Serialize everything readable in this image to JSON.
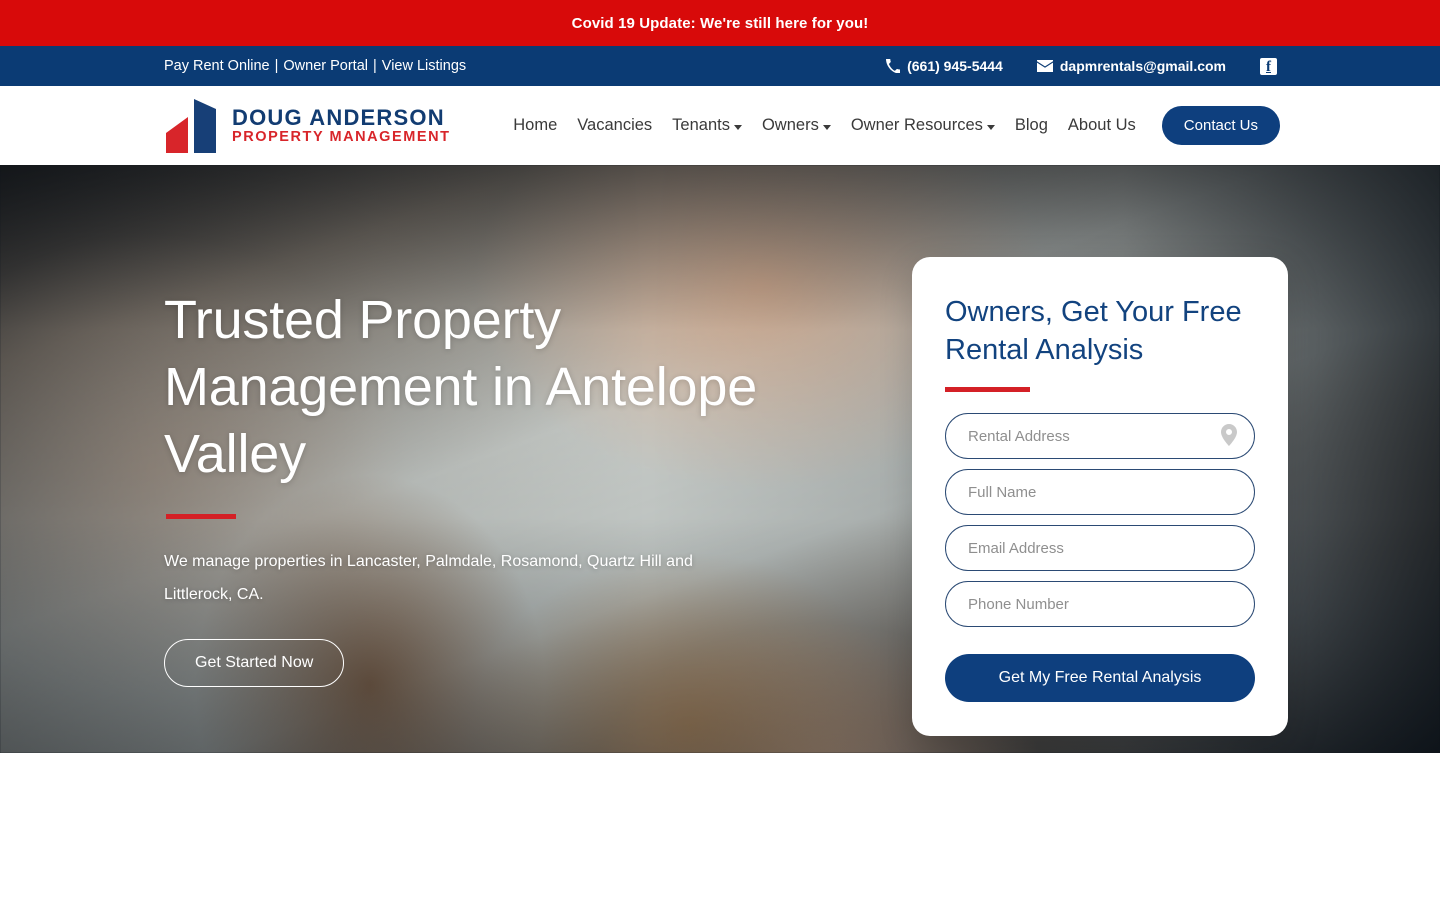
{
  "announcement": {
    "text": "Covid 19 Update: We're still here for you!",
    "bg_color": "#d80a0a",
    "text_color": "#ffffff"
  },
  "utility_bar": {
    "bg_color": "#0b3b74",
    "links": [
      {
        "label": "Pay Rent Online"
      },
      {
        "label": "Owner Portal"
      },
      {
        "label": "View Listings"
      }
    ],
    "separator": "|",
    "phone": {
      "icon": "phone-icon",
      "label": "(661) 945-5444"
    },
    "email": {
      "icon": "envelope-icon",
      "label": "dapmrentals@gmail.com"
    },
    "social": {
      "icon": "facebook-icon",
      "label": "f"
    }
  },
  "header": {
    "logo": {
      "icon": "building-logo-icon",
      "line1": "DOUG ANDERSON",
      "line2": "PROPERTY MANAGEMENT",
      "line1_color": "#123c72",
      "line2_color": "#d8252a"
    },
    "nav": [
      {
        "label": "Home",
        "has_dropdown": false
      },
      {
        "label": "Vacancies",
        "has_dropdown": false
      },
      {
        "label": "Tenants",
        "has_dropdown": true
      },
      {
        "label": "Owners",
        "has_dropdown": true
      },
      {
        "label": "Owner Resources",
        "has_dropdown": true
      },
      {
        "label": "Blog",
        "has_dropdown": false
      },
      {
        "label": "About Us",
        "has_dropdown": false
      }
    ],
    "contact_button": {
      "label": "Contact Us",
      "bg_color": "#0e3f7e"
    }
  },
  "hero": {
    "title": "Trusted Property Management in Antelope Valley",
    "accent_color": "#d42026",
    "subtitle": "We manage properties in Lancaster, Palmdale, Rosamond, Quartz Hill and Littlerock, CA.",
    "cta": {
      "label": "Get Started Now"
    }
  },
  "rental_form": {
    "title": "Owners, Get Your Free Rental Analysis",
    "accent_color": "#d42026",
    "fields": [
      {
        "name": "rental-address",
        "placeholder": "Rental Address",
        "value": "",
        "icon": "map-pin-icon"
      },
      {
        "name": "full-name",
        "placeholder": "Full Name",
        "value": ""
      },
      {
        "name": "email-address",
        "placeholder": "Email Address",
        "value": ""
      },
      {
        "name": "phone-number",
        "placeholder": "Phone Number",
        "value": ""
      }
    ],
    "submit": {
      "label": "Get My Free Rental Analysis",
      "bg_color": "#0e3f7e"
    }
  }
}
